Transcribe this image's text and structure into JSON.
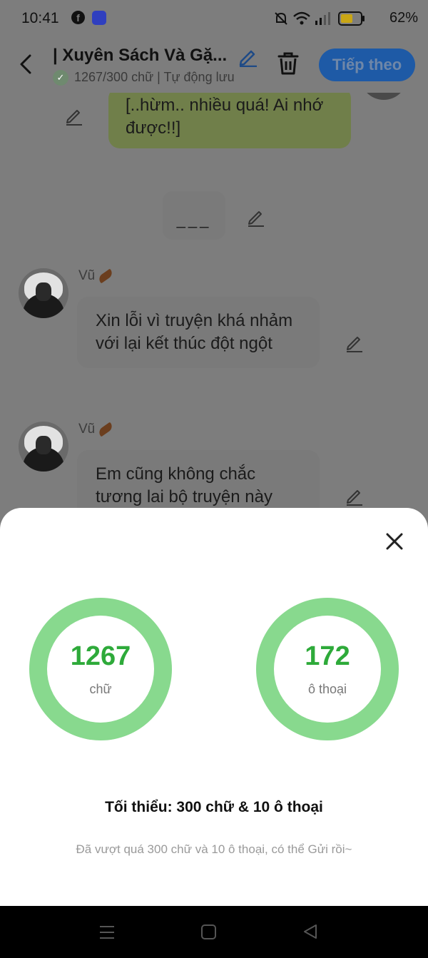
{
  "status_bar": {
    "time": "10:41",
    "battery_pct": "62%",
    "battery_level": 0.62
  },
  "header": {
    "title": "| Xuyên Sách Và Gặ...",
    "subtitle": "1267/300 chữ | Tự động lưu",
    "next_label": "Tiếp theo"
  },
  "chat": {
    "bubble_green_text": "[..hừm.. nhiều quá! Ai nhớ được!!]",
    "separator_text": "___",
    "messages": [
      {
        "author": "Vũ",
        "text": "Xin lỗi vì truyện khá nhảm với lại kết thúc đột ngột"
      },
      {
        "author": "Vũ",
        "text": "Em cũng không chắc tương lai bộ truyện này"
      }
    ]
  },
  "stats_sheet": {
    "words_count": "1267",
    "words_label": "chữ",
    "dialogs_count": "172",
    "dialogs_label": "ô thoại",
    "minimum_text": "Tối thiểu: 300 chữ & 10 ô thoại",
    "hint_text": "Đã vượt quá 300 chữ và 10 ô thoại, có thể Gửi rồi~"
  },
  "colors": {
    "accent_green": "#2eaa3a",
    "ring_green": "#88d98e",
    "next_button_blue": "#1e5aa6",
    "overlay": "#7d7d7d"
  },
  "icons": {
    "back": "chevron-left-icon",
    "edit": "pencil-icon",
    "delete": "trash-icon",
    "close": "close-icon"
  }
}
